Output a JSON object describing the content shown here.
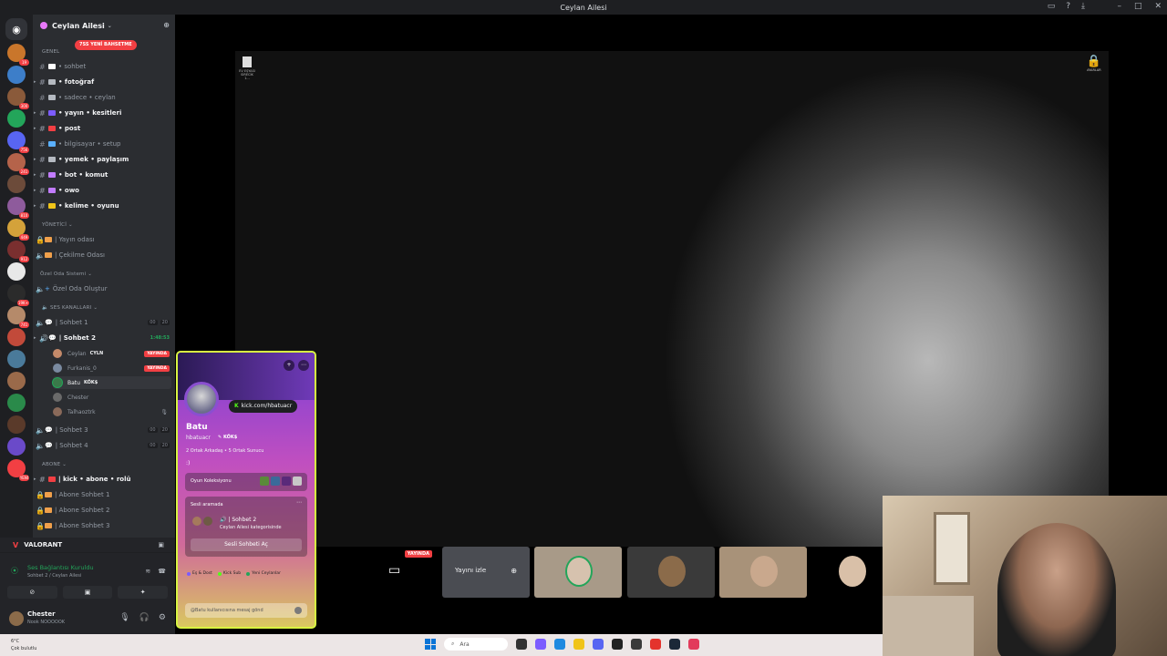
{
  "window": {
    "title": "Ceylan Ailesi"
  },
  "server": {
    "name": "Ceylan Ailesi",
    "new_pill": "7SS YENİ BAHSETME"
  },
  "guild_badges": [
    "19",
    "",
    "300",
    "",
    "756",
    "241",
    "",
    "810",
    "449",
    "912",
    "",
    "19K+",
    "741",
    "",
    "",
    "",
    "",
    "",
    "",
    "YENİ"
  ],
  "categories": {
    "genel": "GENEL",
    "yonetici": "YÖNETİCİ",
    "ozel": "Özel Oda Sistemi",
    "ses": "SES KANALLARI",
    "abone": "ABONE"
  },
  "text_channels": [
    {
      "name": "• sohbet",
      "unread": false,
      "color": "#ffffff"
    },
    {
      "name": "• fotoğraf",
      "unread": true,
      "color": "#b5bac1"
    },
    {
      "name": "• sadece • ceylan",
      "unread": false,
      "color": "#b5bac1"
    },
    {
      "name": "• yayın • kesitleri",
      "unread": true,
      "color": "#7c5cff"
    },
    {
      "name": "• post",
      "unread": true,
      "color": "#f23f43"
    },
    {
      "name": "• bilgisayar • setup",
      "unread": false,
      "color": "#5ab0ff"
    },
    {
      "name": "• yemek • paylaşım",
      "unread": true,
      "color": "#b5bac1"
    },
    {
      "name": "• bot • komut",
      "unread": true,
      "color": "#c27cff"
    },
    {
      "name": "• owo",
      "unread": true,
      "color": "#c27cff"
    },
    {
      "name": "• kelime • oyunu",
      "unread": true,
      "color": "#f0c419"
    }
  ],
  "admin_channels": [
    "| Yayın odası",
    "| Çekilme Odası"
  ],
  "special_room": "Özel Oda Oluştur",
  "voice_channels": {
    "sohbet1": {
      "name": "| Sohbet 1",
      "c1": "00",
      "c2": "20"
    },
    "sohbet2": {
      "name": "| Sohbet 2",
      "timer": "1:48:53"
    },
    "sohbet3": {
      "name": "| Sohbet 3",
      "c1": "00",
      "c2": "20"
    },
    "sohbet4": {
      "name": "| Sohbet 4",
      "c1": "00",
      "c2": "20"
    }
  },
  "voice_users": [
    {
      "name": "Ceylan",
      "tag": "CYLN",
      "live": "YAYINDA"
    },
    {
      "name": "Furkanis_0",
      "tag": "",
      "live": "YAYINDA"
    },
    {
      "name": "Batu",
      "tag": "KÖK$",
      "live": ""
    },
    {
      "name": "Chester",
      "tag": "",
      "live": ""
    },
    {
      "name": "Talhaoztrk",
      "tag": "",
      "live": ""
    }
  ],
  "abone_channels": [
    "| kick • abone • rolü",
    "| Abone Sohbet 1",
    "| Abone Sohbet 2",
    "| Abone Sohbet 3"
  ],
  "activity": {
    "game": "VALORANT"
  },
  "voice_status": {
    "title": "Ses Bağlantısı Kuruldu",
    "sub": "Sohbet 2 / Ceylan Ailesi"
  },
  "user": {
    "name": "Chester",
    "status": "Nook NOOOOOK"
  },
  "profile": {
    "name": "Batu",
    "handle": "hbatuacr",
    "tag": "KÖK$",
    "kick": "kick.com/hbatuacr",
    "mutual": "2 Ortak Arkadaş • 5 Ortak Sunucu",
    "bio": ":)",
    "game_collection": "Oyun Koleksiyonu",
    "voice_section": "Sesli aramada",
    "voice_channel": "| Sohbet 2",
    "voice_category": "Ceylan Ailesi kategorisinde",
    "voice_button": "Sesli Sohbeti Aç",
    "roles": [
      "Eş & Dost",
      "Kick Sub",
      "Yeni Ceylanlar"
    ],
    "message_placeholder": "@Batu kullanıcısına mesaj gönd"
  },
  "stage": {
    "file_label": "EV EŞYASI SİRECİK 1...",
    "lock_label": "AYARLAR",
    "live_badge": "YAYINDA",
    "watch_label": "Yayını izle"
  },
  "taskbar": {
    "temp": "6°C",
    "weather": "Çok bulutlu",
    "search": "Ara"
  }
}
